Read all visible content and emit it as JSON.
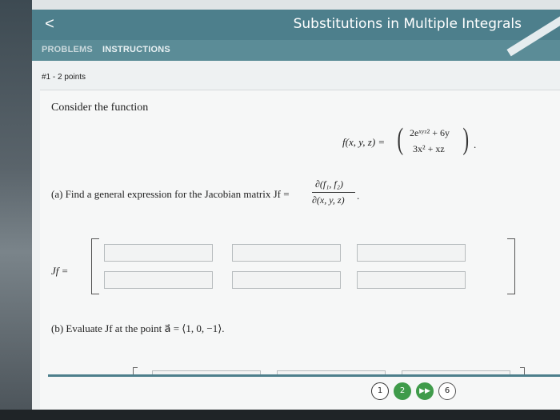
{
  "header": {
    "title": "Substitutions in Multiple Integrals",
    "back_icon": "chevron-left-icon",
    "back_glyph": "<"
  },
  "tabs": [
    {
      "label": "PROBLEMS",
      "active": true
    },
    {
      "label": "INSTRUCTIONS",
      "active": false
    }
  ],
  "problem": {
    "points": "#1 - 2 points",
    "intro": "Consider the function",
    "function_lhs": "f(x, y, z) =",
    "vector_top": "2e^{xyz^2} + 6y",
    "vector_top_display": "2eˣʸᶻ² + 6y",
    "vector_bottom_display": "3x² + xz",
    "trailing_dot": ".",
    "part_a": "(a) Find a general expression for the Jacobian matrix Jf =",
    "frac_num": "∂(f₁, f₂)",
    "frac_den": "∂(x, y, z)",
    "frac_dot": ".",
    "jf_label": "Jf =",
    "matrix_inputs": [
      [
        "",
        "",
        ""
      ],
      [
        "",
        "",
        ""
      ]
    ],
    "part_b": "(b) Evaluate Jf at the point a⃗ = ⟨1, 0, −1⟩."
  },
  "pager": {
    "pages": [
      "1",
      "2"
    ],
    "next_glyph": "▶▶",
    "total": "6"
  },
  "colors": {
    "header": "#4d7f8c",
    "tabs": "#5b8c97",
    "pager_active": "#3f9b4a"
  }
}
